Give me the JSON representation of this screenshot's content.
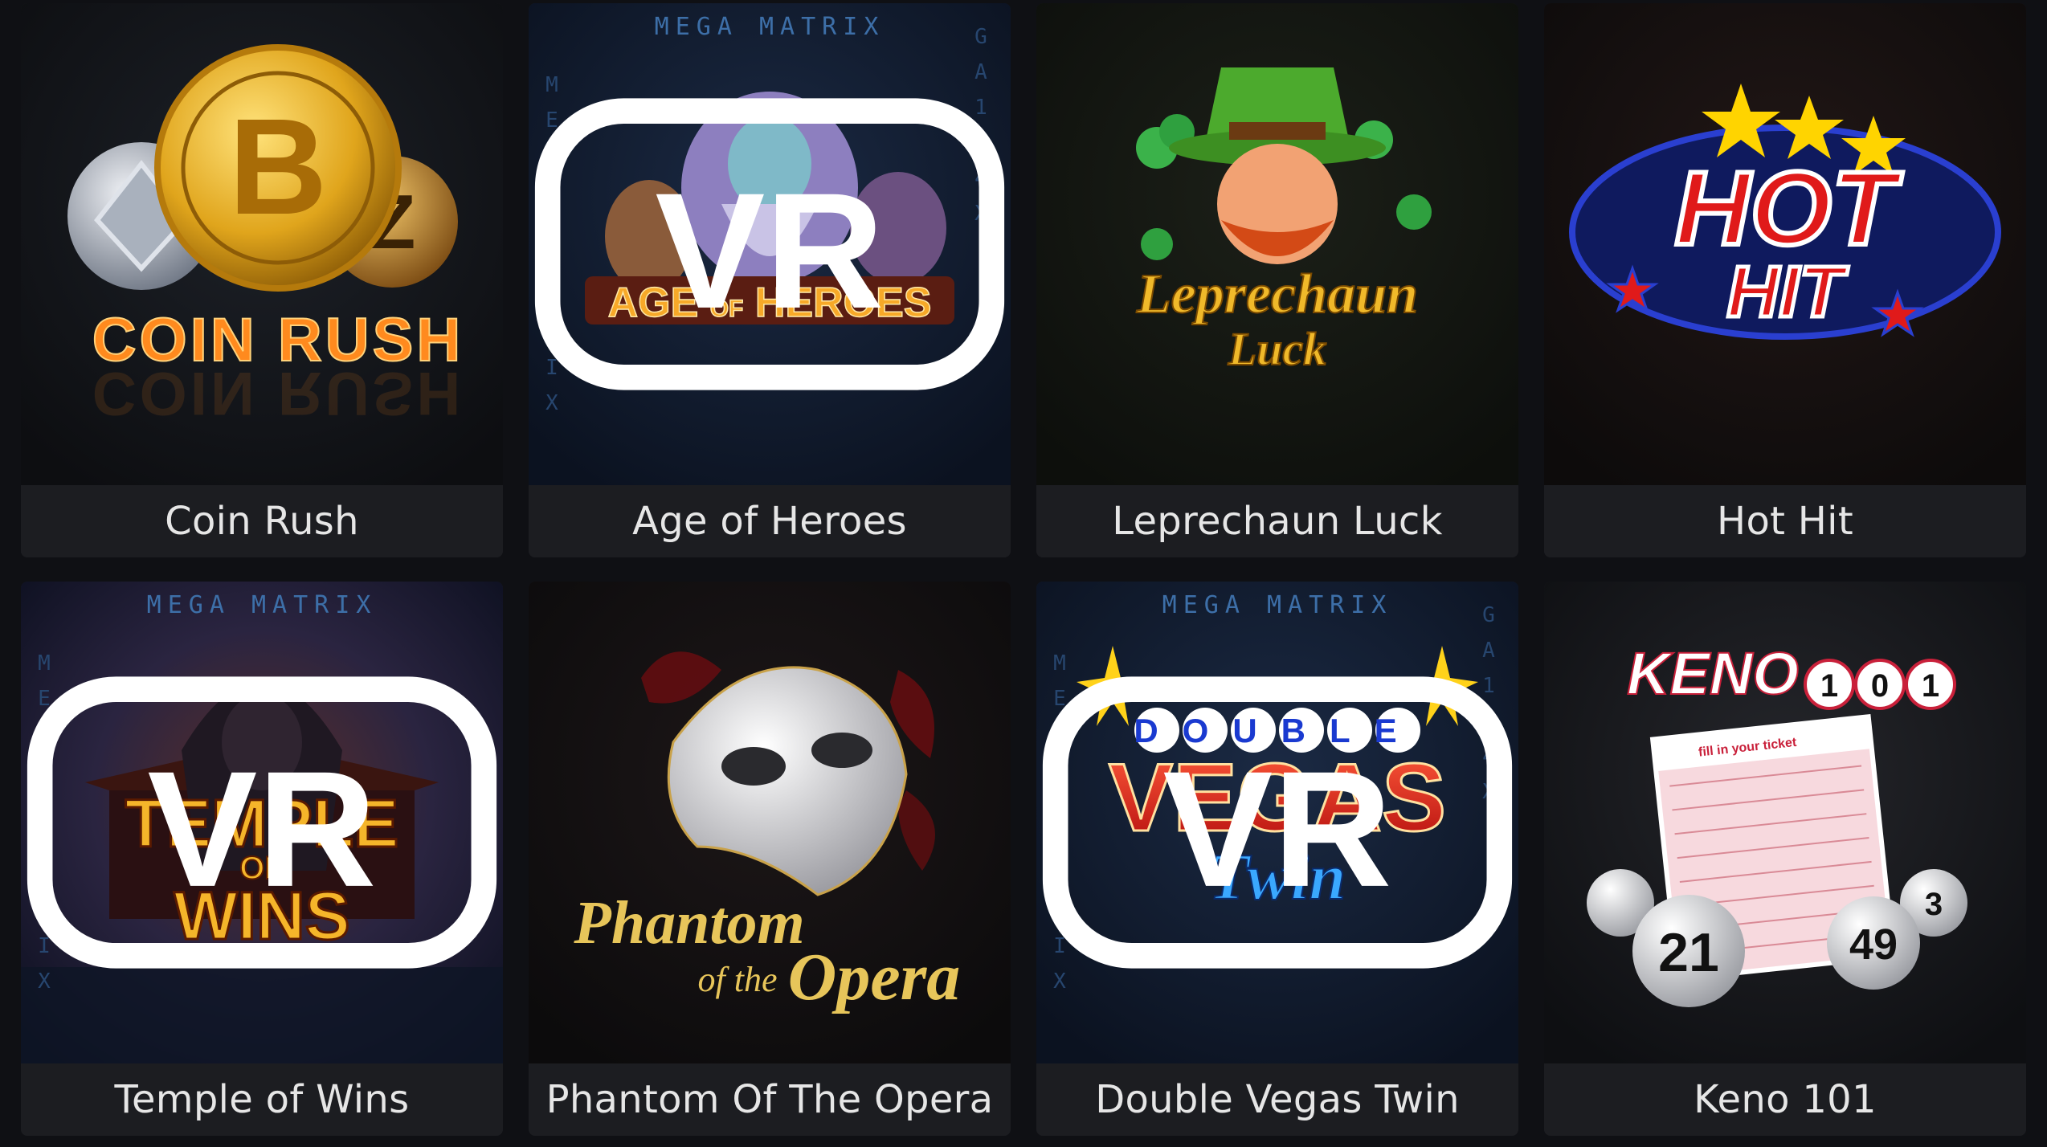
{
  "games": [
    {
      "title": "Coin Rush",
      "logo": "COIN RUSH",
      "vr": false
    },
    {
      "title": "Age of Heroes",
      "logo_line1": "AGE",
      "logo_of": "OF",
      "logo_line2": "HEROES",
      "vr": true,
      "vr_label": "VR",
      "studio": "MEGA MATRIX"
    },
    {
      "title": "Leprechaun Luck",
      "logo_line1": "Leprechaun",
      "logo_line2": "Luck",
      "vr": false
    },
    {
      "title": "Hot Hit",
      "logo_line1": "HOT",
      "logo_line2": "HIT",
      "vr": false
    },
    {
      "title": "Temple of Wins",
      "logo_line1": "TEMPLE",
      "logo_of": "OF",
      "logo_line2": "WINS",
      "vr": true,
      "vr_label": "VR",
      "studio": "MEGA MATRIX"
    },
    {
      "title": "Phantom Of The Opera",
      "logo_line1": "Phantom",
      "logo_mid": "of the",
      "logo_line2": "Opera",
      "vr": false
    },
    {
      "title": "Double Vegas Twin",
      "logo_line1": "DOUBLE",
      "logo_line2": "VEGAS",
      "logo_line3": "Twin",
      "vr": true,
      "vr_label": "VR",
      "studio": "MEGA MATRIX"
    },
    {
      "title": "Keno 101",
      "logo": "KENO",
      "logo_balls": [
        "1",
        "0",
        "1"
      ],
      "ticket_header": "fill in your ticket",
      "ball_numbers": [
        "21",
        "49",
        "3"
      ],
      "vr": false
    }
  ],
  "colors": {
    "page_bg": "#0f1014",
    "card_caption_bg": "#1c1d21",
    "caption_text": "#e6e6e6",
    "matrix_blue": "#3d6fa8"
  }
}
